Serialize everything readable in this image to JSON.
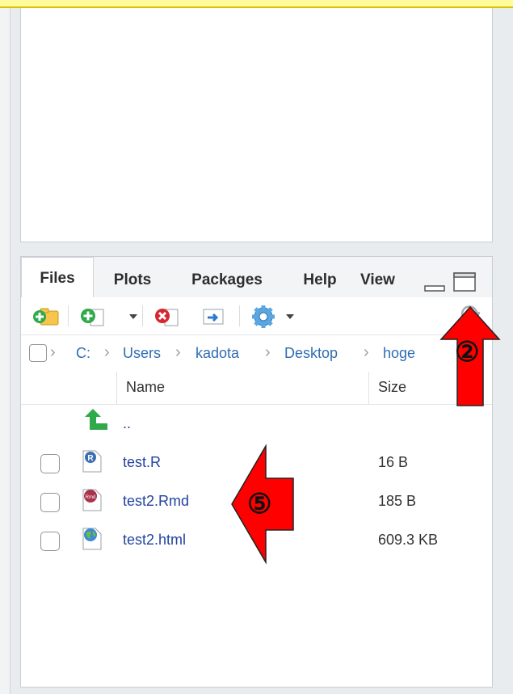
{
  "tabs": [
    {
      "label": "Files",
      "active": true
    },
    {
      "label": "Plots",
      "active": false
    },
    {
      "label": "Packages",
      "active": false
    },
    {
      "label": "Help",
      "active": false
    },
    {
      "label": "View",
      "active": false
    }
  ],
  "toolbar": {
    "icons": [
      "new-folder-icon",
      "new-file-icon",
      "delete-icon",
      "rename-icon",
      "more-gear-icon",
      "refresh-icon"
    ]
  },
  "path": {
    "segments": [
      "C:",
      "Users",
      "kadota",
      "Desktop",
      "hoge"
    ]
  },
  "table": {
    "headers": {
      "name": "Name",
      "size": "Size"
    },
    "parent_label": "..",
    "rows": [
      {
        "name": "test.R",
        "size": "16 B",
        "icon": "r-file-icon"
      },
      {
        "name": "test2.Rmd",
        "size": "185 B",
        "icon": "rmd-file-icon"
      },
      {
        "name": "test2.html",
        "size": "609.3 KB",
        "icon": "html-file-icon"
      }
    ]
  },
  "annotations": {
    "marker_2": "②",
    "marker_5": "⑤"
  },
  "colors": {
    "link": "#2244a0",
    "path_link": "#2f6db3",
    "callout_fill": "#ff0000",
    "top_strip": "#fffb9c"
  }
}
